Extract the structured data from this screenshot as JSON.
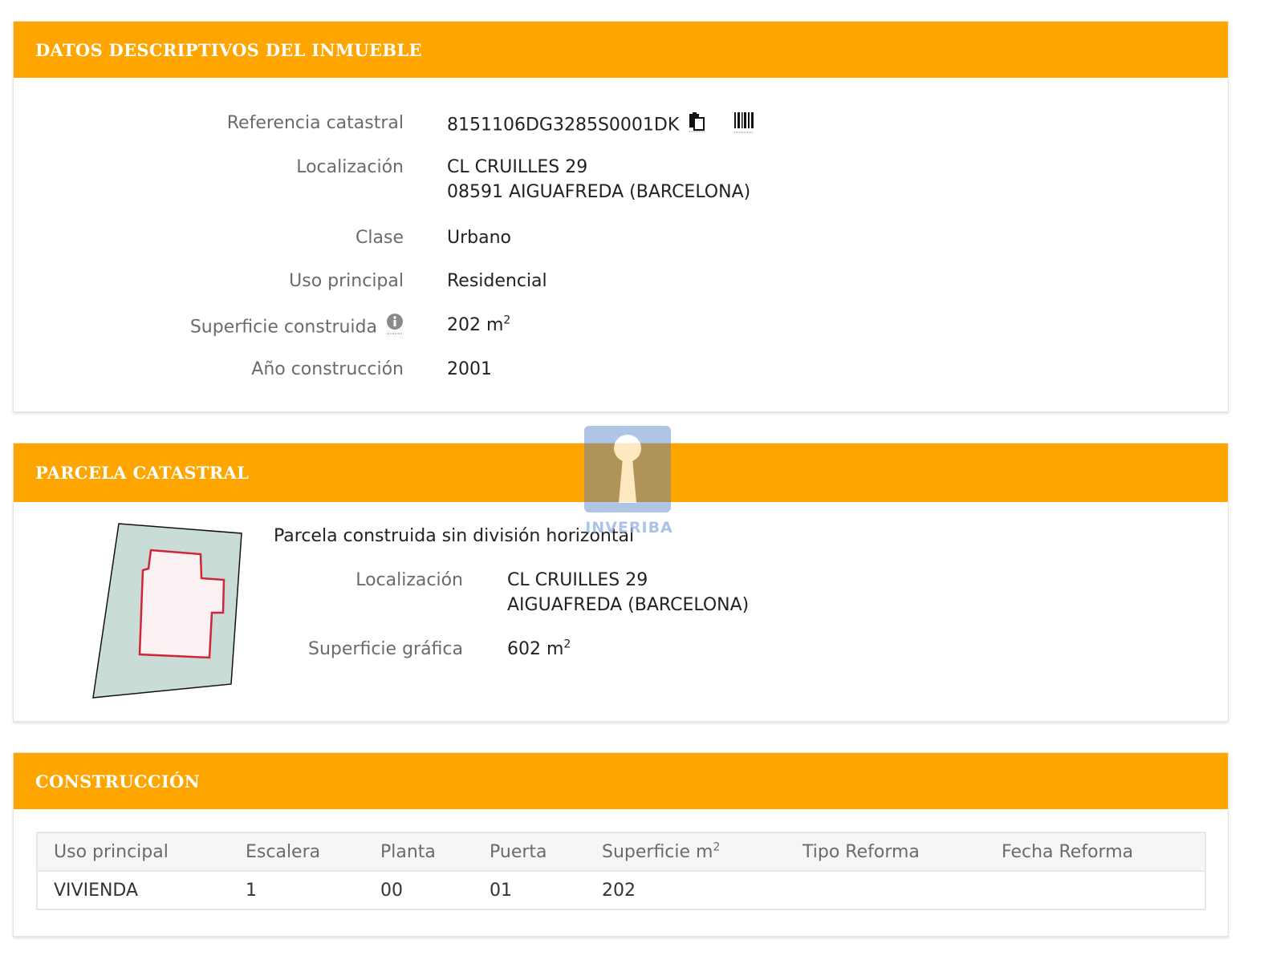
{
  "section1": {
    "title": "DATOS DESCRIPTIVOS DEL INMUEBLE",
    "rows": [
      {
        "label": "Referencia catastral",
        "value": "8151106DG3285S0001DK"
      },
      {
        "label": "Localización",
        "value_line1": "CL CRUILLES 29",
        "value_line2": "08591 AIGUAFREDA (BARCELONA)"
      },
      {
        "label": "Clase",
        "value": "Urbano"
      },
      {
        "label": "Uso principal",
        "value": "Residencial"
      },
      {
        "label": "Superficie construida",
        "value": "202 m",
        "value_sup": "2"
      },
      {
        "label": "Año construcción",
        "value": "2001"
      }
    ]
  },
  "section2": {
    "title": "PARCELA CATASTRAL",
    "subtitle": "Parcela construida sin división horizontal",
    "rows": [
      {
        "label": "Localización",
        "value_line1": "CL CRUILLES 29",
        "value_line2": "AIGUAFREDA (BARCELONA)"
      },
      {
        "label": "Superficie gráfica",
        "value": "602 m",
        "value_sup": "2"
      }
    ]
  },
  "section3": {
    "title": "CONSTRUCCIÓN",
    "columns": [
      "Uso principal",
      "Escalera",
      "Planta",
      "Puerta",
      "Superficie m",
      "Tipo Reforma",
      "Fecha Reforma"
    ],
    "column_sup": "2",
    "rows": [
      [
        "VIVIENDA",
        "1",
        "00",
        "01",
        "202",
        "",
        ""
      ]
    ]
  },
  "watermark": {
    "text": "INVERIBA"
  },
  "colors": {
    "header": "#fea500",
    "parcel_fill": "#c9ddd6",
    "building_outline": "#d0243a"
  }
}
